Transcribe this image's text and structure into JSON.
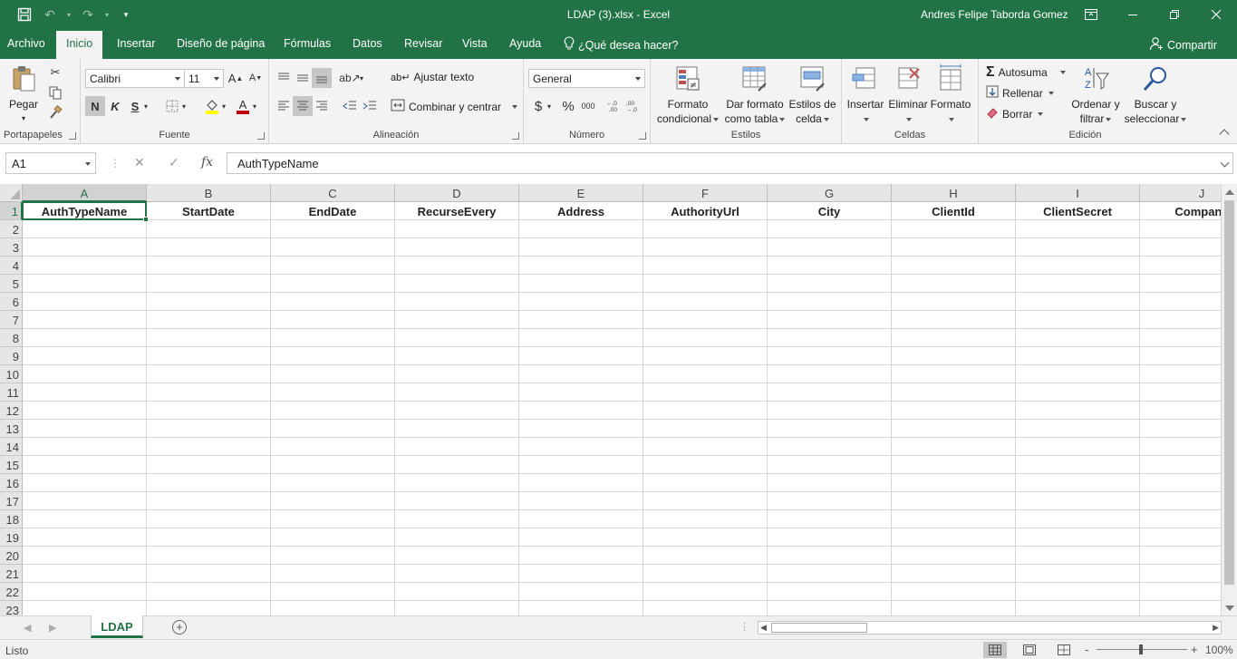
{
  "window": {
    "title": "LDAP (3).xlsx  -  Excel",
    "user": "Andres Felipe Taborda Gomez"
  },
  "tabs": [
    "Archivo",
    "Inicio",
    "Insertar",
    "Diseño de página",
    "Fórmulas",
    "Datos",
    "Revisar",
    "Vista",
    "Ayuda"
  ],
  "active_tab": "Inicio",
  "tell_me": "¿Qué desea hacer?",
  "share": "Compartir",
  "ribbon": {
    "clipboard": {
      "label": "Portapapeles",
      "paste": "Pegar"
    },
    "font": {
      "label": "Fuente",
      "name": "Calibri",
      "size": "11",
      "bold": "N",
      "italic": "K",
      "underline": "S",
      "font_color": "#c00000",
      "fill_color": "#ffff00"
    },
    "alignment": {
      "label": "Alineación",
      "wrap": "Ajustar texto",
      "merge": "Combinar y centrar"
    },
    "number": {
      "label": "Número",
      "format": "General",
      "currency": "$",
      "percent": "%",
      "thousands": "000",
      "inc_dec": ",00\n,0",
      "dec_dec": ",00\n,0"
    },
    "styles": {
      "label": "Estilos",
      "conditional": [
        "Formato",
        "condicional"
      ],
      "as_table": [
        "Dar formato",
        "como tabla"
      ],
      "cell_styles": [
        "Estilos de",
        "celda"
      ]
    },
    "cells": {
      "label": "Celdas",
      "insert": "Insertar",
      "delete": "Eliminar",
      "format": "Formato"
    },
    "editing": {
      "label": "Edición",
      "autosum": "Autosuma",
      "fill": "Rellenar",
      "clear": "Borrar",
      "sort": [
        "Ordenar y",
        "filtrar"
      ],
      "find": [
        "Buscar y",
        "seleccionar"
      ]
    }
  },
  "formula_bar": {
    "name_box": "A1",
    "cancel": "✕",
    "enter": "✓",
    "fx": "fx",
    "content": "AuthTypeName"
  },
  "sheet": {
    "columns": [
      "A",
      "B",
      "C",
      "D",
      "E",
      "F",
      "G",
      "H",
      "I",
      "J"
    ],
    "rows": [
      "1",
      "2",
      "3",
      "4",
      "5",
      "6",
      "7",
      "8",
      "9",
      "10",
      "11",
      "12",
      "13",
      "14",
      "15",
      "16",
      "17",
      "18",
      "19",
      "20",
      "21",
      "22",
      "23"
    ],
    "header_row": [
      "AuthTypeName",
      "StartDate",
      "EndDate",
      "RecurseEvery",
      "Address",
      "AuthorityUrl",
      "City",
      "ClientId",
      "ClientSecret",
      "Company"
    ],
    "selected_cell": "A1",
    "tabs": [
      "LDAP"
    ],
    "active_sheet": "LDAP"
  },
  "status": {
    "text": "Listo",
    "zoom": "100%",
    "zoom_minus": "-",
    "zoom_plus": "+"
  },
  "colors": {
    "accent": "#217346",
    "ribbon_bg": "#f3f3f3"
  }
}
